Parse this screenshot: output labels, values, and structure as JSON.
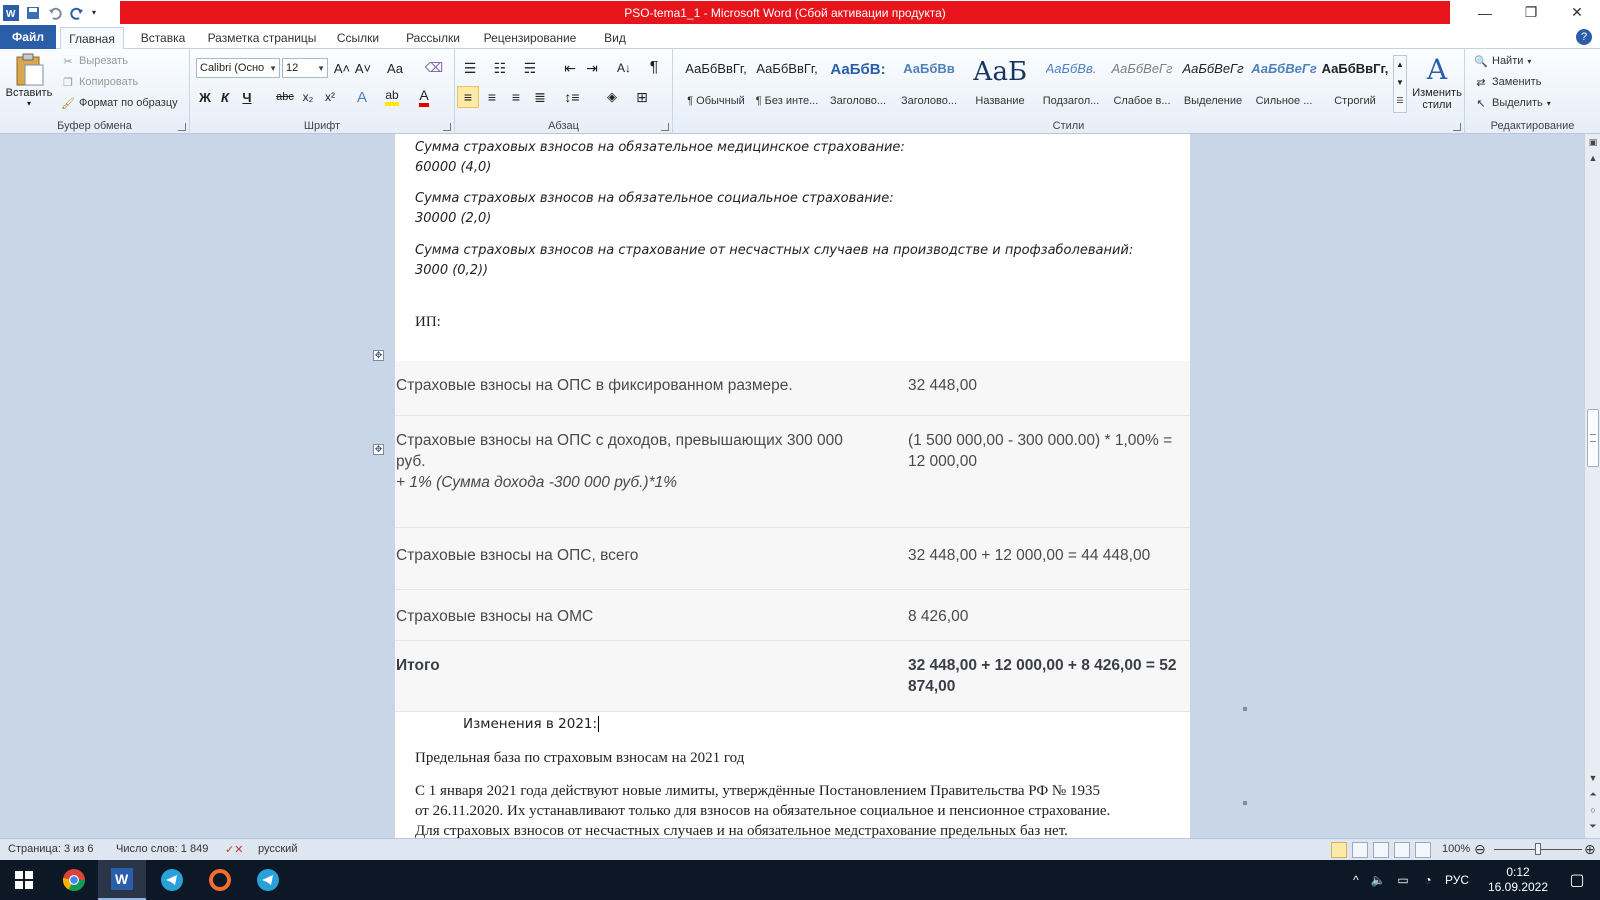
{
  "window": {
    "title": "PSO-tema1_1 - Microsoft Word (Сбой активации продукта)",
    "controls": {
      "minimize": "—",
      "restore": "❐",
      "close": "✕"
    }
  },
  "ribbon_tabs": [
    "Файл",
    "Главная",
    "Вставка",
    "Разметка страницы",
    "Ссылки",
    "Рассылки",
    "Рецензирование",
    "Вид"
  ],
  "clipboard": {
    "paste": "Вставить",
    "cut": "Вырезать",
    "copy": "Копировать",
    "format_painter": "Формат по образцу",
    "label": "Буфер обмена"
  },
  "font": {
    "name": "Calibri (Осно",
    "size": "12",
    "label": "Шрифт",
    "grow": "A˄",
    "shrink": "A˅",
    "case": "Aa",
    "bold": "Ж",
    "italic": "К",
    "underline": "Ч",
    "strike": "abc",
    "subscript": "x₂",
    "superscript": "x²"
  },
  "paragraph": {
    "label": "Абзац",
    "pilcrow": "¶"
  },
  "styles": {
    "label": "Стили",
    "items": [
      {
        "sample": "АаБбВвГг,",
        "name": "¶ Обычный"
      },
      {
        "sample": "АаБбВвГг,",
        "name": "¶ Без инте..."
      },
      {
        "sample": "АаБбВ:",
        "name": "Заголово..."
      },
      {
        "sample": "АаБбВв",
        "name": "Заголово..."
      },
      {
        "sample": "АаБ",
        "name": "Название"
      },
      {
        "sample": "АаБбВв.",
        "name": "Подзагол..."
      },
      {
        "sample": "АаБбВеГг",
        "name": "Слабое в..."
      },
      {
        "sample": "АаБбВеГг",
        "name": "Выделение"
      },
      {
        "sample": "АаБбВеГг",
        "name": "Сильное ..."
      },
      {
        "sample": "АаБбВвГг,",
        "name": "Строгий"
      }
    ],
    "change_styles": "Изменить стили"
  },
  "editing": {
    "label": "Редактирование",
    "find": "Найти",
    "replace": "Заменить",
    "select": "Выделить"
  },
  "document": {
    "p1_line1": "Сумма страховых взносов на обязательное медицинское страхование:",
    "p1_line2": "60000 (4,0)",
    "p2_line1": "Сумма страховых взносов на обязательное социальное страхование:",
    "p2_line2": "30000 (2,0)",
    "p3_line1": "Сумма страховых взносов на страхование от несчастных случаев на производстве и профзаболеваний:",
    "p3_line2": "3000 (0,2))",
    "ip_label": "ИП:",
    "table": [
      {
        "label": "Страховые взносы на ОПС в фиксированном размере.",
        "value": "32 448,00"
      },
      {
        "label": "Страховые взносы на ОПС с доходов, превышающих 300 000 руб.",
        "label_extra": "+ 1% (Сумма дохода -300 000 руб.)*1%",
        "value": "(1 500 000,00 - 300 000.00) * 1,00% = 12 000,00"
      },
      {
        "label": "Страховые взносы на ОПС, всего",
        "value": "32 448,00 + 12 000,00 = 44 448,00"
      },
      {
        "label": "Страховые взносы на ОМС",
        "value": "8 426,00"
      },
      {
        "label": "Итого",
        "value": "32 448,00 + 12 000,00 + 8 426,00 = 52 874,00"
      }
    ],
    "changes_heading": "Изменения в 2021:",
    "base_heading": "Предельная база по страховым взносам на 2021 год",
    "body_line1": "С 1 января 2021 года действуют новые лимиты, утверждённые Постановлением Правительства РФ № 1935",
    "body_line2": "от 26.11.2020. Их устанавливают только для взносов на обязательное социальное и пенсионное страхование.",
    "body_line3": "Для страховых взносов от несчастных случаев и на обязательное медстрахование предельных баз нет."
  },
  "statusbar": {
    "page": "Страница: 3 из 6",
    "words": "Число слов: 1 849",
    "language": "русский",
    "zoom": "100%",
    "zoom_fraction": 0.5
  },
  "taskbar": {
    "language": "РУС",
    "time": "0:12",
    "date": "16.09.2022"
  },
  "colors": {
    "title_red": "#e8141c",
    "file_tab": "#2b5ea8",
    "doc_background": "#c9d6e8",
    "taskbar": "#0d1826"
  }
}
